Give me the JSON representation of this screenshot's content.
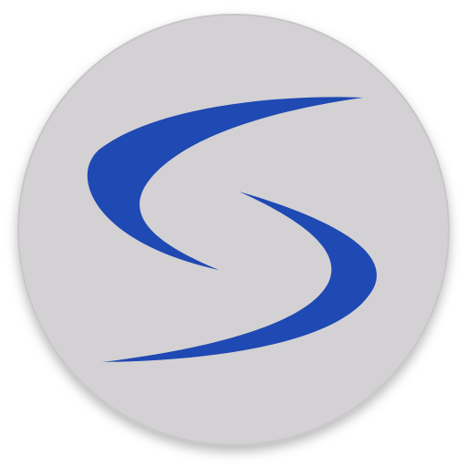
{
  "icon": {
    "name": "swoosh-s-logo",
    "colors": {
      "disc": "#d3d1d3",
      "disc_edge": "#c8c6c8",
      "mark": "#1f49b3",
      "page_background": "#ffffff"
    }
  }
}
